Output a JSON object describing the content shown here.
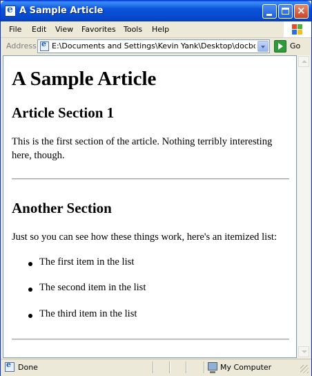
{
  "window": {
    "title": "A Sample Article",
    "icon": "internet-explorer-icon",
    "accent": "#0a53d9"
  },
  "menubar": {
    "items": [
      "File",
      "Edit",
      "View",
      "Favorites",
      "Tools",
      "Help"
    ]
  },
  "addressbar": {
    "label": "Address",
    "value": "E:\\Documents and Settings\\Kevin Yank\\Desktop\\docbook.xml",
    "go_label": "Go"
  },
  "article": {
    "title": "A Sample Article",
    "sections": [
      {
        "heading": "Article Section 1",
        "paragraph": "This is the first section of the article. Nothing terribly interesting here, though."
      },
      {
        "heading": "Another Section",
        "paragraph": "Just so you can see how these things work, here's an itemized list:",
        "list": [
          "The first item in the list",
          "The second item in the list",
          "The third item in the list"
        ]
      }
    ]
  },
  "statusbar": {
    "status": "Done",
    "zone": "My Computer"
  }
}
